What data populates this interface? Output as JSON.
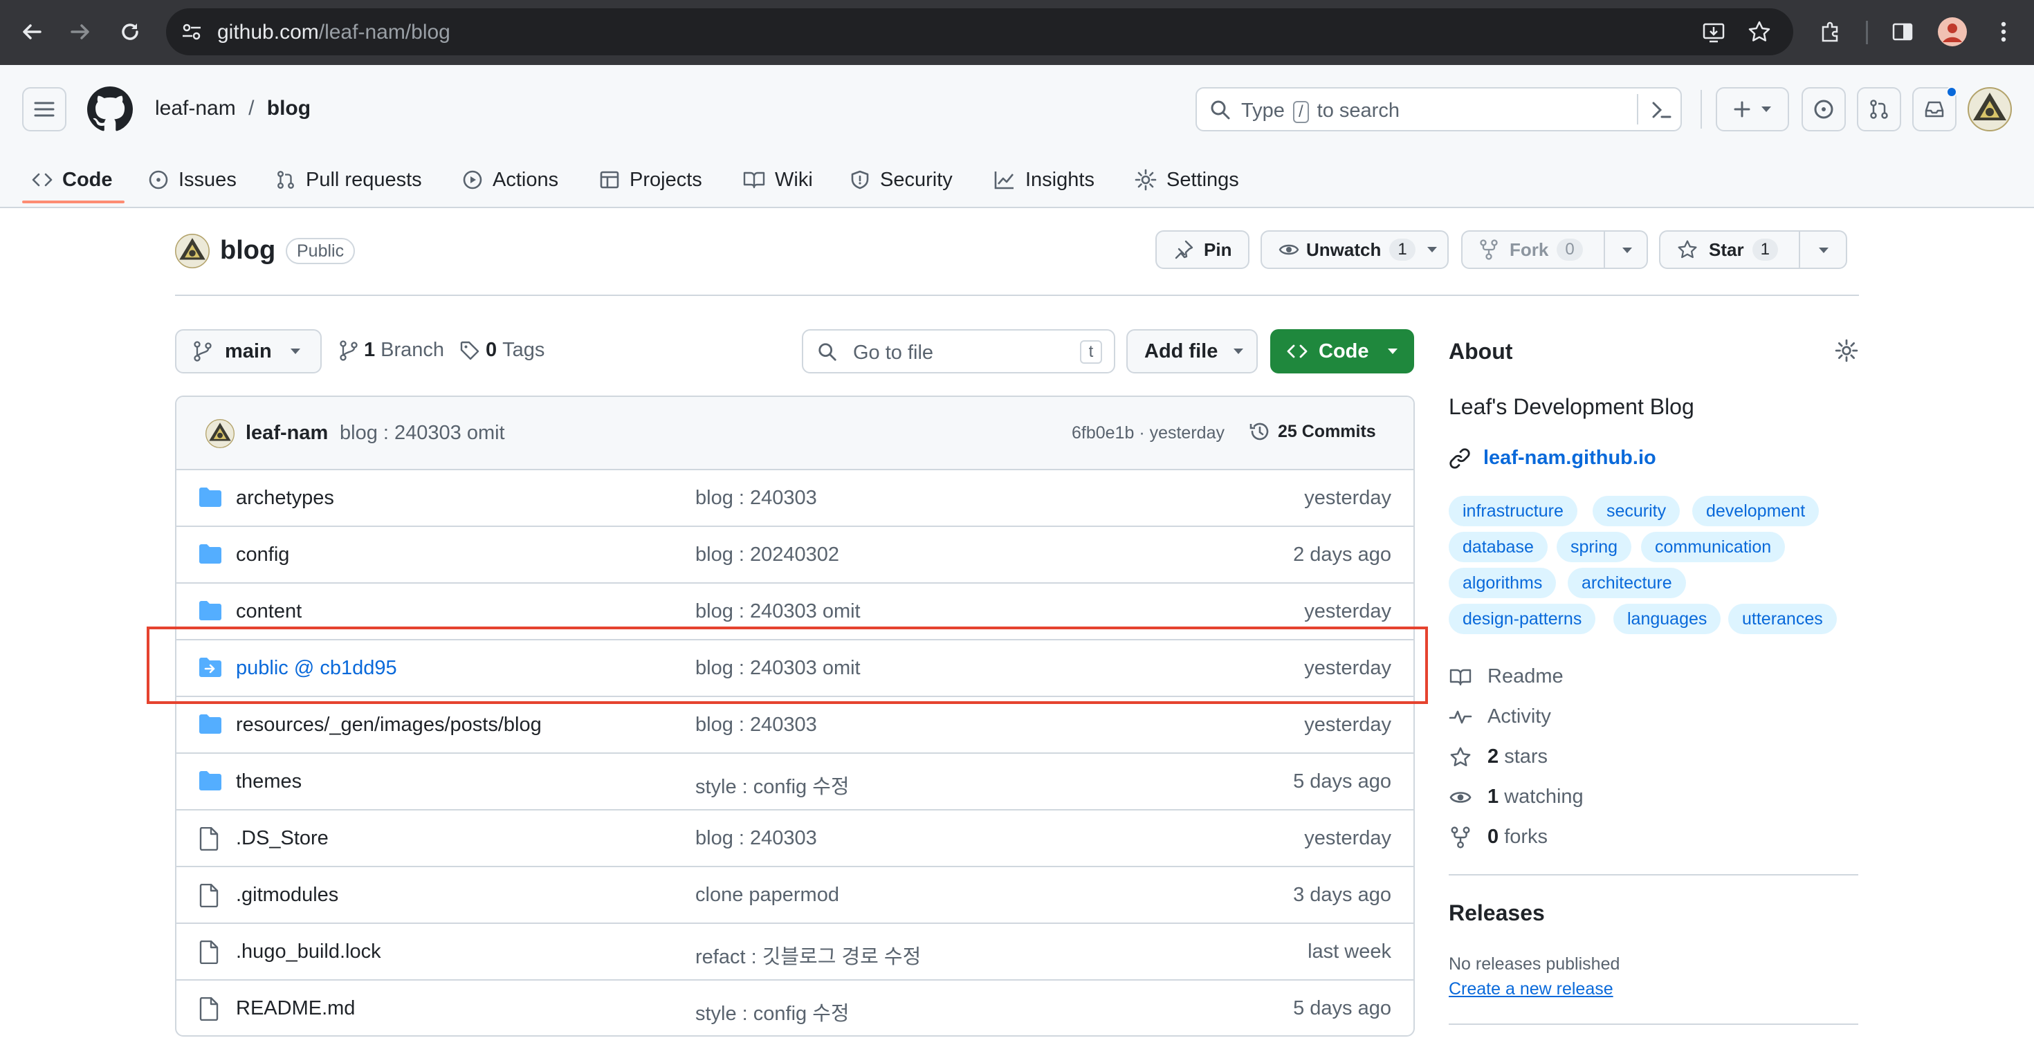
{
  "browser": {
    "url_host": "github.com",
    "url_path": "/leaf-nam/blog"
  },
  "header": {
    "owner": "leaf-nam",
    "separator": "/",
    "repo": "blog",
    "search_prefix": "Type",
    "search_key": "/",
    "search_suffix": "to search"
  },
  "tabs": [
    {
      "label": "Code",
      "icon": "code-icon",
      "active": true
    },
    {
      "label": "Issues",
      "icon": "issue-icon"
    },
    {
      "label": "Pull requests",
      "icon": "pull-request-icon"
    },
    {
      "label": "Actions",
      "icon": "play-icon"
    },
    {
      "label": "Projects",
      "icon": "table-icon"
    },
    {
      "label": "Wiki",
      "icon": "book-icon"
    },
    {
      "label": "Security",
      "icon": "shield-icon"
    },
    {
      "label": "Insights",
      "icon": "graph-icon"
    },
    {
      "label": "Settings",
      "icon": "gear-icon"
    }
  ],
  "repo": {
    "name": "blog",
    "visibility": "Public",
    "pin_label": "Pin",
    "unwatch_label": "Unwatch",
    "unwatch_count": "1",
    "fork_label": "Fork",
    "fork_count": "0",
    "star_label": "Star",
    "star_count": "1"
  },
  "toolbar": {
    "branch": "main",
    "branch_count": "1",
    "branch_label": "Branch",
    "tag_count": "0",
    "tag_label": "Tags",
    "goto_placeholder": "Go to file",
    "goto_key": "t",
    "add_file_label": "Add file",
    "code_label": "Code"
  },
  "last_commit": {
    "author": "leaf-nam",
    "message": "blog : 240303 omit",
    "meta": "6fb0e1b · yesterday",
    "commits_label": "25 Commits"
  },
  "files": [
    {
      "name": "archetypes",
      "type": "folder",
      "message": "blog : 240303",
      "date": "yesterday"
    },
    {
      "name": "config",
      "type": "folder",
      "message": "blog : 20240302",
      "date": "2 days ago"
    },
    {
      "name": "content",
      "type": "folder",
      "message": "blog : 240303 omit",
      "date": "yesterday"
    },
    {
      "name": "public @ cb1dd95",
      "type": "submodule",
      "message": "blog : 240303 omit",
      "date": "yesterday",
      "highlighted": true
    },
    {
      "name": "resources/_gen/images/posts/blog",
      "type": "folder",
      "message": "blog : 240303",
      "date": "yesterday"
    },
    {
      "name": "themes",
      "type": "folder",
      "message": "style : config 수정",
      "date": "5 days ago"
    },
    {
      "name": ".DS_Store",
      "type": "file",
      "message": "blog : 240303",
      "date": "yesterday"
    },
    {
      "name": ".gitmodules",
      "type": "file",
      "message": "clone papermod",
      "date": "3 days ago"
    },
    {
      "name": ".hugo_build.lock",
      "type": "file",
      "message": "refact : 깃블로그 경로 수정",
      "date": "last week"
    },
    {
      "name": "README.md",
      "type": "file",
      "message": "style : config 수정",
      "date": "5 days ago"
    }
  ],
  "about": {
    "heading": "About",
    "description": "Leaf's Development Blog",
    "website": "leaf-nam.github.io",
    "topics": [
      "infrastructure",
      "security",
      "development",
      "database",
      "spring",
      "communication",
      "algorithms",
      "architecture",
      "design-patterns",
      "languages",
      "utterances"
    ],
    "readme_label": "Readme",
    "activity_label": "Activity",
    "stars_count": "2",
    "stars_label": "stars",
    "watching_count": "1",
    "watching_label": "watching",
    "forks_count": "0",
    "forks_label": "forks"
  },
  "releases": {
    "heading": "Releases",
    "none_text": "No releases published",
    "create_link": "Create a new release"
  },
  "colors": {
    "accent_green": "#1f883d",
    "link_blue": "#0969da",
    "highlight_red": "#e5432f",
    "active_tab_underline": "#fd8c73"
  }
}
